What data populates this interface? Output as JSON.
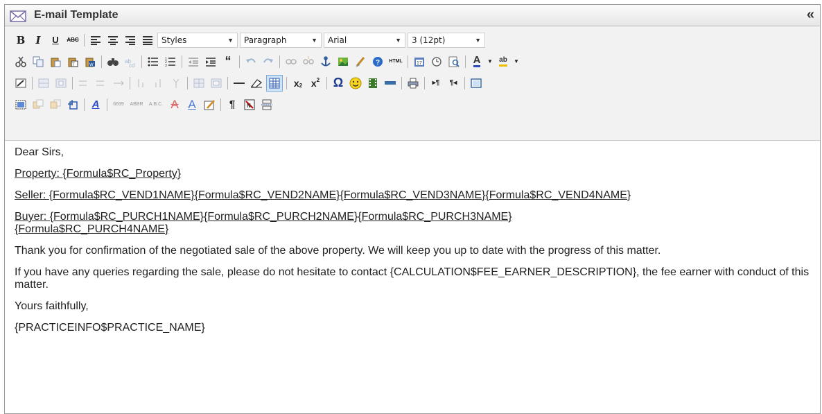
{
  "window": {
    "title": "E-mail Template",
    "collapse_glyph": "«"
  },
  "toolbar": {
    "format_buttons": {
      "bold": "B",
      "italic": "I",
      "underline": "U",
      "strike": "ABC"
    },
    "styles": {
      "selected": "Styles"
    },
    "paragraph": {
      "selected": "Paragraph"
    },
    "font": {
      "selected": "Arial"
    },
    "size": {
      "selected": "3 (12pt)"
    },
    "row2_icons": [
      "cut-icon",
      "copy-icon",
      "paste-icon",
      "paste-text-icon",
      "paste-word-icon",
      "find-icon",
      "replace-icon",
      "bullet-list-icon",
      "numbered-list-icon",
      "outdent-icon",
      "indent-icon",
      "blockquote-icon",
      "undo-icon",
      "redo-icon",
      "link-icon",
      "unlink-icon",
      "anchor-icon",
      "image-icon",
      "cleanup-icon",
      "help-icon",
      "html-icon",
      "insert-date-icon",
      "insert-time-icon",
      "preview-icon",
      "forecolor-icon",
      "backcolor-icon"
    ],
    "html_label": "HTML",
    "row3_icons": [
      "table-icon",
      "row-props-icon",
      "cell-props-icon",
      "insert-row-before-icon",
      "insert-row-after-icon",
      "delete-row-icon",
      "insert-col-before-icon",
      "insert-col-after-icon",
      "delete-col-icon",
      "split-cells-icon",
      "merge-cells-icon",
      "hr-icon",
      "remove-format-icon",
      "visual-aid-icon",
      "subscript-icon",
      "superscript-icon",
      "charmap-icon",
      "emoticons-icon",
      "media-icon",
      "advhr-icon",
      "print-icon",
      "ltr-icon",
      "rtl-icon",
      "fullscreen-icon"
    ],
    "row4_icons": [
      "insert-layer-icon",
      "move-forward-icon",
      "move-backward-icon",
      "absolute-icon",
      "styleprops-icon",
      "cite-icon",
      "abbr-icon",
      "acronym-icon",
      "del-icon",
      "ins-icon",
      "attribs-icon",
      "visualchars-icon",
      "nonbreaking-icon",
      "pagebreak-icon"
    ],
    "sub_label": "x",
    "sup_label": "x",
    "omega": "Ω",
    "pilcrow": "¶",
    "quote_glyph": "“",
    "cite_text": "6699",
    "abbr_text": "ABBR",
    "acronym_text": "A.B.C."
  },
  "content": {
    "greeting": "Dear Sirs,",
    "property_line": "Property: {Formula$RC_Property}",
    "seller_line": "Seller: {Formula$RC_VEND1NAME}{Formula$RC_VEND2NAME}{Formula$RC_VEND3NAME}{Formula$RC_VEND4NAME}",
    "buyer_line_1": "Buyer: {Formula$RC_PURCH1NAME}{Formula$RC_PURCH2NAME}{Formula$RC_PURCH3NAME}",
    "buyer_line_2": "{Formula$RC_PURCH4NAME}",
    "para1": "Thank you for confirmation of the negotiated sale of the above property. We will keep you up to date with the progress of this matter.",
    "para2": "If you have any queries regarding the sale, please do not hesitate to contact {CALCULATION$FEE_EARNER_DESCRIPTION}, the fee earner with conduct of this matter.",
    "closing": "Yours faithfully,",
    "signature": "{PRACTICEINFO$PRACTICE_NAME}"
  }
}
